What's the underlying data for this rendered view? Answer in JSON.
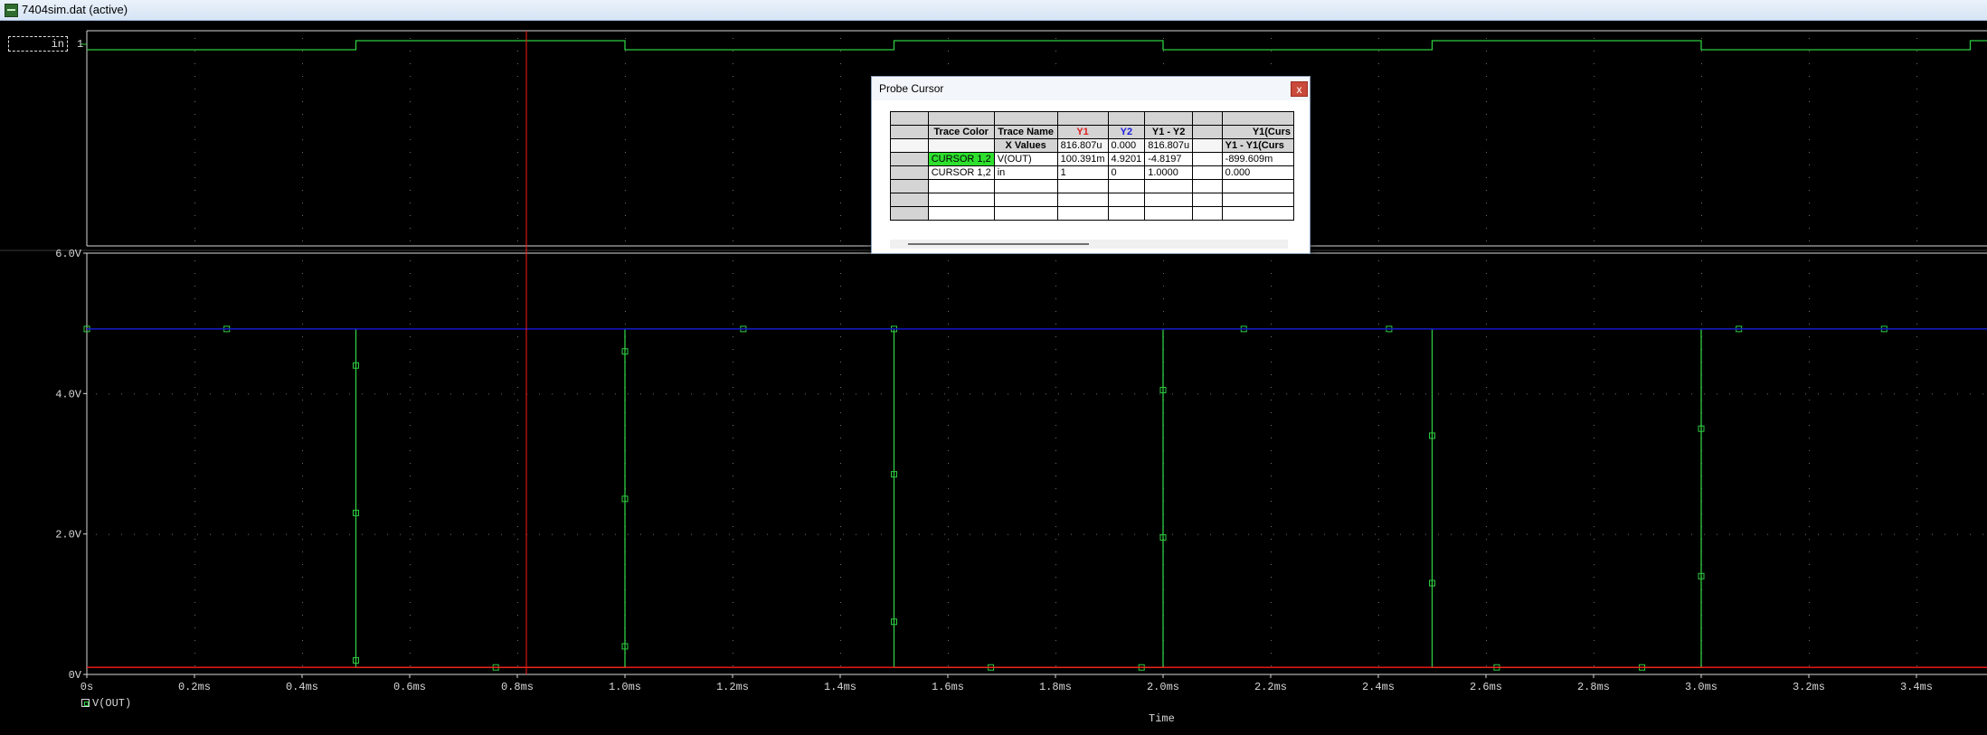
{
  "window": {
    "title": "7404sim.dat (active)"
  },
  "digital_plot": {
    "trace_label": "in",
    "level_label": "1"
  },
  "analog_plot": {
    "y_ticks": [
      "6.0V",
      "4.0V",
      "2.0V",
      "0V"
    ],
    "x_ticks": [
      "0s",
      "0.2ms",
      "0.4ms",
      "0.6ms",
      "0.8ms",
      "1.0ms",
      "1.2ms",
      "1.4ms",
      "1.6ms",
      "1.8ms",
      "2.0ms",
      "2.2ms",
      "2.4ms",
      "2.6ms",
      "2.8ms",
      "3.0ms",
      "3.2ms",
      "3.4ms"
    ],
    "x_title": "Time",
    "legend": "V(OUT)"
  },
  "colors": {
    "trace_green": "#2ecc40",
    "cursor_red": "#ff1a1a",
    "cursor2_blue": "#1414c8",
    "axis_white": "#d8d8d8",
    "grid_dot": "#6e6e6e"
  },
  "chart_data": {
    "type": "line",
    "xlabel": "Time",
    "x_unit": "ms",
    "xlim": [
      0,
      3.54
    ],
    "ylim": [
      0,
      6.0
    ],
    "grid": true,
    "series": [
      {
        "name": "V(OUT)",
        "x": [
          0,
          0.5,
          0.5,
          1.0,
          1.0,
          1.5,
          1.5,
          2.0,
          2.0,
          2.5,
          2.5,
          3.0,
          3.0,
          3.54
        ],
        "y": [
          4.92,
          4.92,
          0.1,
          0.1,
          4.92,
          4.92,
          0.1,
          0.1,
          4.92,
          4.92,
          0.1,
          0.1,
          4.92,
          4.92
        ]
      },
      {
        "name": "in",
        "x": [
          0,
          0.5,
          0.5,
          1.0,
          1.0,
          1.5,
          1.5,
          2.0,
          2.0,
          2.5,
          2.5,
          3.0,
          3.0,
          3.5,
          3.5,
          3.54
        ],
        "y": [
          0,
          0,
          1,
          1,
          0,
          0,
          1,
          1,
          0,
          0,
          1,
          1,
          0,
          0,
          1,
          1
        ]
      }
    ],
    "cursors": [
      {
        "name": "Y1",
        "x_ms": 0.8168,
        "y": 0.1004
      },
      {
        "name": "Y2",
        "x_ms": 0.0,
        "y": 4.9201
      }
    ]
  },
  "probe_cursor": {
    "title": "Probe Cursor",
    "close_label": "x",
    "headers": [
      "Trace Color",
      "Trace Name",
      "Y1",
      "Y2",
      "Y1 - Y2",
      "",
      "Y1(Curs"
    ],
    "x_values_row": [
      "",
      "X Values",
      "816.807u",
      "0.000",
      "816.807u",
      "",
      "Y1 - Y1(Curs"
    ],
    "rows": [
      [
        "CURSOR 1,2",
        "V(OUT)",
        "100.391m",
        "4.9201",
        "-4.8197",
        "",
        "-899.609m"
      ],
      [
        "CURSOR 1,2",
        "in",
        "1",
        "0",
        "1.0000",
        "",
        "0.000"
      ]
    ]
  }
}
